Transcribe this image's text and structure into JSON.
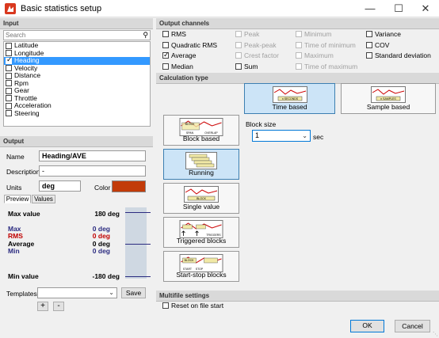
{
  "window": {
    "title": "Basic statistics setup",
    "minimize": "—",
    "maximize": "☐",
    "close": "✕"
  },
  "input": {
    "header": "Input",
    "search_placeholder": "Search",
    "channels": [
      {
        "label": "Latitude",
        "checked": false,
        "selected": false
      },
      {
        "label": "Longitude",
        "checked": false,
        "selected": false
      },
      {
        "label": "Heading",
        "checked": true,
        "selected": true
      },
      {
        "label": "Velocity",
        "checked": false,
        "selected": false
      },
      {
        "label": "Distance",
        "checked": false,
        "selected": false
      },
      {
        "label": "Rpm",
        "checked": false,
        "selected": false
      },
      {
        "label": "Gear",
        "checked": false,
        "selected": false
      },
      {
        "label": "Throttle",
        "checked": false,
        "selected": false
      },
      {
        "label": "Acceleration",
        "checked": false,
        "selected": false
      },
      {
        "label": "Steering",
        "checked": false,
        "selected": false
      }
    ]
  },
  "output": {
    "header": "Output",
    "name_label": "Name",
    "name_value": "Heading/AVE",
    "description_label": "Description",
    "description_value": "-",
    "units_label": "Units",
    "units_value": "deg",
    "color_label": "Color",
    "color_value": "#c23b09",
    "tabs": {
      "preview": "Preview",
      "values": "Values"
    },
    "preview": {
      "max_label": "Max value",
      "max_value": "180 deg",
      "rows": [
        {
          "label": "Max",
          "value": "0 deg",
          "color": "#2b2b80"
        },
        {
          "label": "RMS",
          "value": "0 deg",
          "color": "#c00000"
        },
        {
          "label": "Average",
          "value": "0 deg",
          "color": "#000000"
        },
        {
          "label": "Min",
          "value": "0 deg",
          "color": "#2b2b80"
        }
      ],
      "min_label": "Min value",
      "min_value": "-180 deg"
    },
    "templates_label": "Templates",
    "save_button": "Save",
    "add_button": "+",
    "remove_button": "-"
  },
  "output_channels": {
    "header": "Output channels",
    "items": [
      {
        "label": "RMS",
        "checked": false,
        "disabled": false
      },
      {
        "label": "Quadratic RMS",
        "checked": false,
        "disabled": false
      },
      {
        "label": "Average",
        "checked": true,
        "disabled": false
      },
      {
        "label": "Median",
        "checked": false,
        "disabled": false
      },
      {
        "label": "Peak",
        "checked": false,
        "disabled": true
      },
      {
        "label": "Peak-peak",
        "checked": false,
        "disabled": true
      },
      {
        "label": "Crest factor",
        "checked": false,
        "disabled": true
      },
      {
        "label": "Sum",
        "checked": false,
        "disabled": false
      },
      {
        "label": "Minimum",
        "checked": false,
        "disabled": true
      },
      {
        "label": "Time of minimum",
        "checked": false,
        "disabled": true
      },
      {
        "label": "Maximum",
        "checked": false,
        "disabled": true
      },
      {
        "label": "Time of maximum",
        "checked": false,
        "disabled": true
      },
      {
        "label": "Variance",
        "checked": false,
        "disabled": false
      },
      {
        "label": "COV",
        "checked": false,
        "disabled": false
      },
      {
        "label": "Standard deviation",
        "checked": false,
        "disabled": false
      }
    ]
  },
  "calculation_type": {
    "header": "Calculation type",
    "tiles": {
      "time_based": {
        "label": "Time based",
        "img_text": "n SECONDS",
        "selected": true
      },
      "sample_based": {
        "label": "Sample based",
        "img_text": "n SAMPLES",
        "selected": false
      },
      "block_based": {
        "label": "Block based",
        "img_text_1": "BLOCK",
        "img_text_2": "SPAN",
        "img_text_3": "OVERLAP",
        "selected": false
      },
      "running": {
        "label": "Running",
        "selected": true
      },
      "single_value": {
        "label": "Single value",
        "img_text": "BLOCK",
        "selected": false
      },
      "triggered_blocks": {
        "label": "Triggered blocks",
        "img_text": "TRIGGERS",
        "selected": false
      },
      "start_stop_blocks": {
        "label": "Start-stop blocks",
        "img_text_1": "BLOCK",
        "img_text_2": "START",
        "img_text_3": "STOP",
        "selected": false
      }
    },
    "block_size_label": "Block size",
    "block_size_value": "1",
    "block_size_unit": "sec"
  },
  "multifile": {
    "header": "Multifile settings",
    "reset_label": "Reset on file start",
    "reset_checked": false
  },
  "footer": {
    "ok": "OK",
    "cancel": "Cancel"
  }
}
